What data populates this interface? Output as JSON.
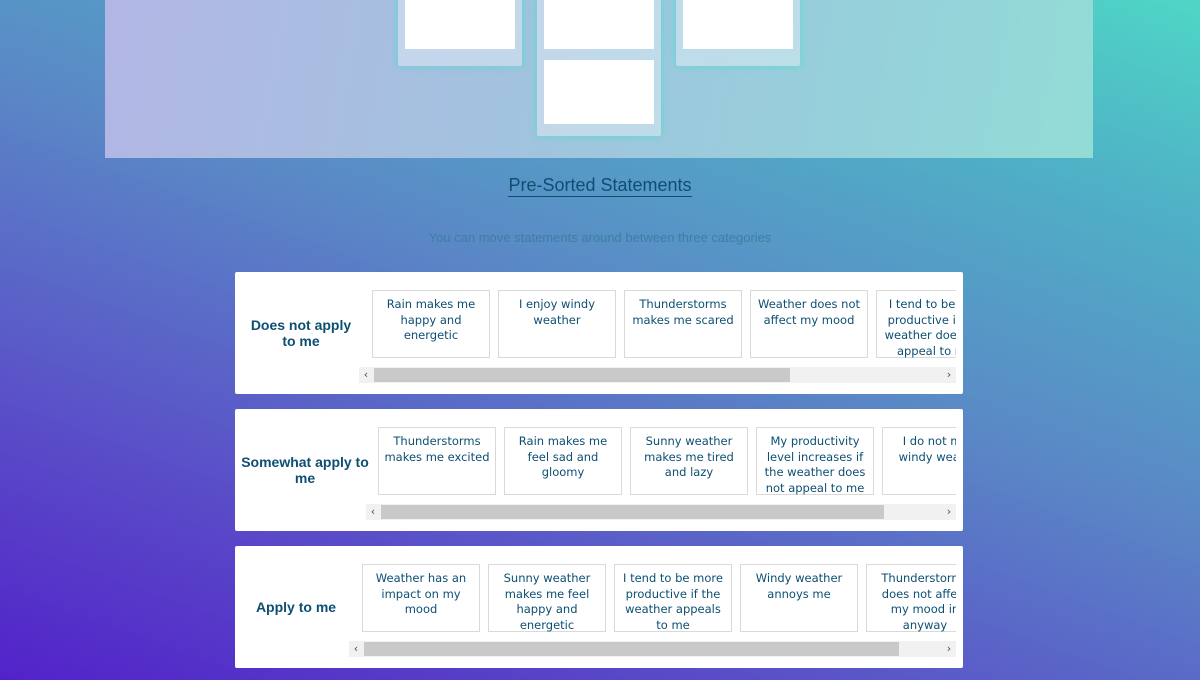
{
  "header": {
    "title": "Pre-Sorted Statements",
    "subtitle": "You can move statements around between three categories"
  },
  "categories": [
    {
      "label": "Does not apply to me",
      "statements": [
        "Rain makes me happy and energetic",
        "I enjoy windy weather",
        "Thunderstorms makes me scared",
        "Weather does not affect my mood",
        "I tend to be less productive if the weather does not appeal to me"
      ]
    },
    {
      "label": "Somewhat apply to me",
      "statements": [
        "Thunderstorms makes me excited",
        "Rain makes me feel sad and gloomy",
        "Sunny weather makes me tired and lazy",
        "My productivity level increases if the weather does not appeal to me",
        "I do not mind windy weather"
      ]
    },
    {
      "label": "Apply to me",
      "statements": [
        "Weather has an impact on my mood",
        "Sunny weather makes me feel happy and energetic",
        "I tend to be more productive if the weather appeals to me",
        "Windy weather annoys me",
        "Thunderstorms does not affect my mood in anyway"
      ]
    }
  ],
  "scrollbar": {
    "left_arrow": "‹",
    "right_arrow": "›"
  }
}
